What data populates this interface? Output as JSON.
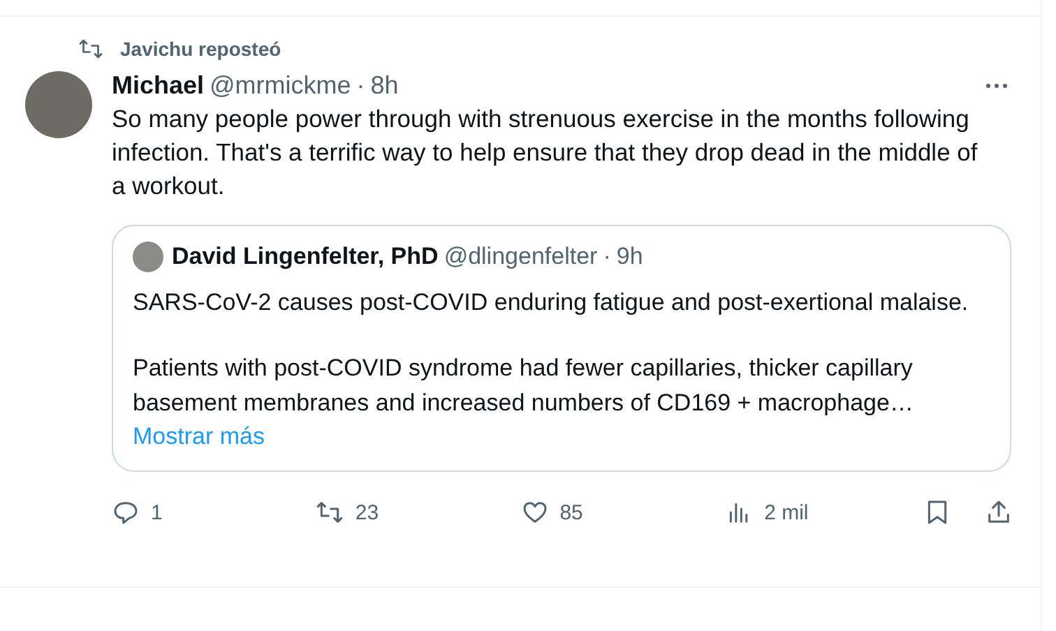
{
  "repost": {
    "label": "Javichu reposteó"
  },
  "post": {
    "name": "Michael",
    "handle": "@mrmickme",
    "separator": "·",
    "time": "8h",
    "text": "So many people power through with strenuous exercise in the months following infection. That's a terrific way to help ensure that they drop dead in the middle of a workout.",
    "quote": {
      "name": "David Lingenfelter, PhD",
      "handle": "@dlingenfelter",
      "separator": "·",
      "time": "9h",
      "paragraphs": [
        "SARS-CoV-2 causes post-COVID enduring fatigue and post-exertional malaise.",
        "Patients with post-COVID syndrome had fewer capillaries, thicker capillary basement membranes and increased numbers of CD169 + macrophage…"
      ],
      "more": "Mostrar más"
    },
    "actions": [
      {
        "kind": "reply",
        "count": "1"
      },
      {
        "kind": "repost",
        "count": "23"
      },
      {
        "kind": "like",
        "count": "85"
      },
      {
        "kind": "views",
        "count": "2 mil"
      },
      {
        "kind": "bookmark"
      },
      {
        "kind": "share"
      }
    ]
  }
}
